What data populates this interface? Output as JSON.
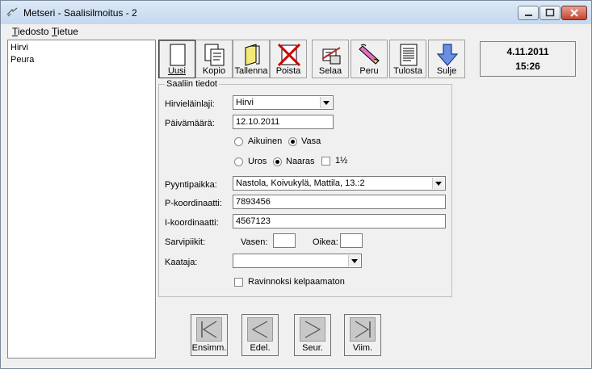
{
  "window": {
    "title": "Metseri - Saalisilmoitus - 2"
  },
  "menu": {
    "items": [
      {
        "key": "T",
        "rest": "iedosto"
      },
      {
        "key": "T",
        "rest": "ietue"
      }
    ]
  },
  "list": {
    "items": [
      "Hirvi",
      "Peura"
    ]
  },
  "toolbar": {
    "buttons": [
      {
        "label": "Uusi",
        "icon": "new-document-icon"
      },
      {
        "label": "Kopio",
        "icon": "copy-icon"
      },
      {
        "label": "Tallenna",
        "icon": "save-folder-icon"
      },
      {
        "label": "Poista",
        "icon": "delete-x-icon"
      },
      {
        "label": "Selaa",
        "icon": "browse-icon"
      },
      {
        "label": "Peru",
        "icon": "undo-eraser-icon"
      },
      {
        "label": "Tulosta",
        "icon": "print-document-icon"
      },
      {
        "label": "Sulje",
        "icon": "close-arrow-down-icon"
      }
    ]
  },
  "clock": {
    "date": "4.11.2011",
    "time": "15:26"
  },
  "form": {
    "group_title": "Saaliin tiedot",
    "species_label": "Hirvieläinlaji:",
    "species_value": "Hirvi",
    "date_label": "Päivämäärä:",
    "date_value": "12.10.2011",
    "age_adult": "Aikuinen",
    "age_calf": "Vasa",
    "sex_male": "Uros",
    "sex_female": "Naaras",
    "one_half": "1½",
    "place_label": "Pyyntipaikka:",
    "place_value": "Nastola, Koivukylä, Mattila, 13.:2",
    "p_label": "P-koordinaatti:",
    "p_value": "7893456",
    "i_label": "I-koordinaatti:",
    "i_value": "4567123",
    "antler_label": "Sarvipiikit:",
    "antler_left": "Vasen:",
    "antler_right": "Oikea:",
    "hunter_label": "Kaataja:",
    "unfit_label": "Ravinnoksi kelpaamaton"
  },
  "nav": {
    "buttons": [
      "Ensimm.",
      "Edel.",
      "Seur.",
      "Viim."
    ]
  }
}
